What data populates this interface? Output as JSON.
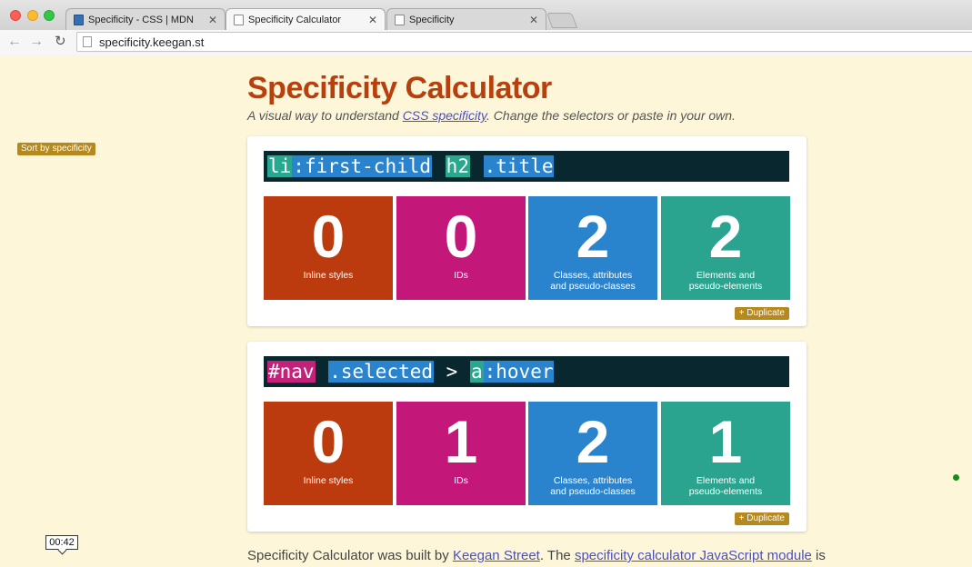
{
  "browser": {
    "tabs": [
      {
        "label": "Specificity - CSS | MDN",
        "active": false,
        "icon": "mdn-icon"
      },
      {
        "label": "Specificity Calculator",
        "active": true,
        "icon": "page-icon"
      },
      {
        "label": "Specificity",
        "active": false,
        "icon": "page-icon"
      }
    ],
    "close_glyph": "✕",
    "url": "specificity.keegan.st"
  },
  "page": {
    "sort_button": "Sort by specificity",
    "title": "Specificity Calculator",
    "subtitle_pre": "A visual way to understand ",
    "subtitle_link": "CSS specificity",
    "subtitle_post": ". Change the selectors or paste in your own.",
    "duplicate_label": "+ Duplicate"
  },
  "calculators": [
    {
      "tokens": [
        {
          "text": "li",
          "kind": "el"
        },
        {
          "text": ":first-child",
          "kind": "cls"
        },
        {
          "text": " ",
          "kind": "plain"
        },
        {
          "text": "h2",
          "kind": "el"
        },
        {
          "text": " ",
          "kind": "plain"
        },
        {
          "text": ".title",
          "kind": "cls"
        }
      ],
      "scores": [
        {
          "value": "0",
          "label": "Inline styles"
        },
        {
          "value": "0",
          "label": "IDs"
        },
        {
          "value": "2",
          "label": "Classes, attributes\nand pseudo-classes"
        },
        {
          "value": "2",
          "label": "Elements and\npseudo-elements"
        }
      ]
    },
    {
      "tokens": [
        {
          "text": "#nav",
          "kind": "id"
        },
        {
          "text": " ",
          "kind": "plain"
        },
        {
          "text": ".selected",
          "kind": "cls"
        },
        {
          "text": " > ",
          "kind": "plain"
        },
        {
          "text": "a",
          "kind": "el"
        },
        {
          "text": ":hover",
          "kind": "cls"
        }
      ],
      "scores": [
        {
          "value": "0",
          "label": "Inline styles"
        },
        {
          "value": "1",
          "label": "IDs"
        },
        {
          "value": "2",
          "label": "Classes, attributes\nand pseudo-classes"
        },
        {
          "value": "1",
          "label": "Elements and\npseudo-elements"
        }
      ]
    }
  ],
  "footer": {
    "pre": "Specificity Calculator was built by ",
    "link1": "Keegan Street",
    "mid": ". The ",
    "link2": "specificity calculator JavaScript module",
    "post": " is"
  },
  "overlay": {
    "timer": "00:42"
  },
  "colors": {
    "inline": "#bb3b0e",
    "ids": "#c3177a",
    "classes": "#2a83cd",
    "elements": "#2aa48f",
    "accent_button": "#b5891d",
    "title": "#b8400e"
  }
}
